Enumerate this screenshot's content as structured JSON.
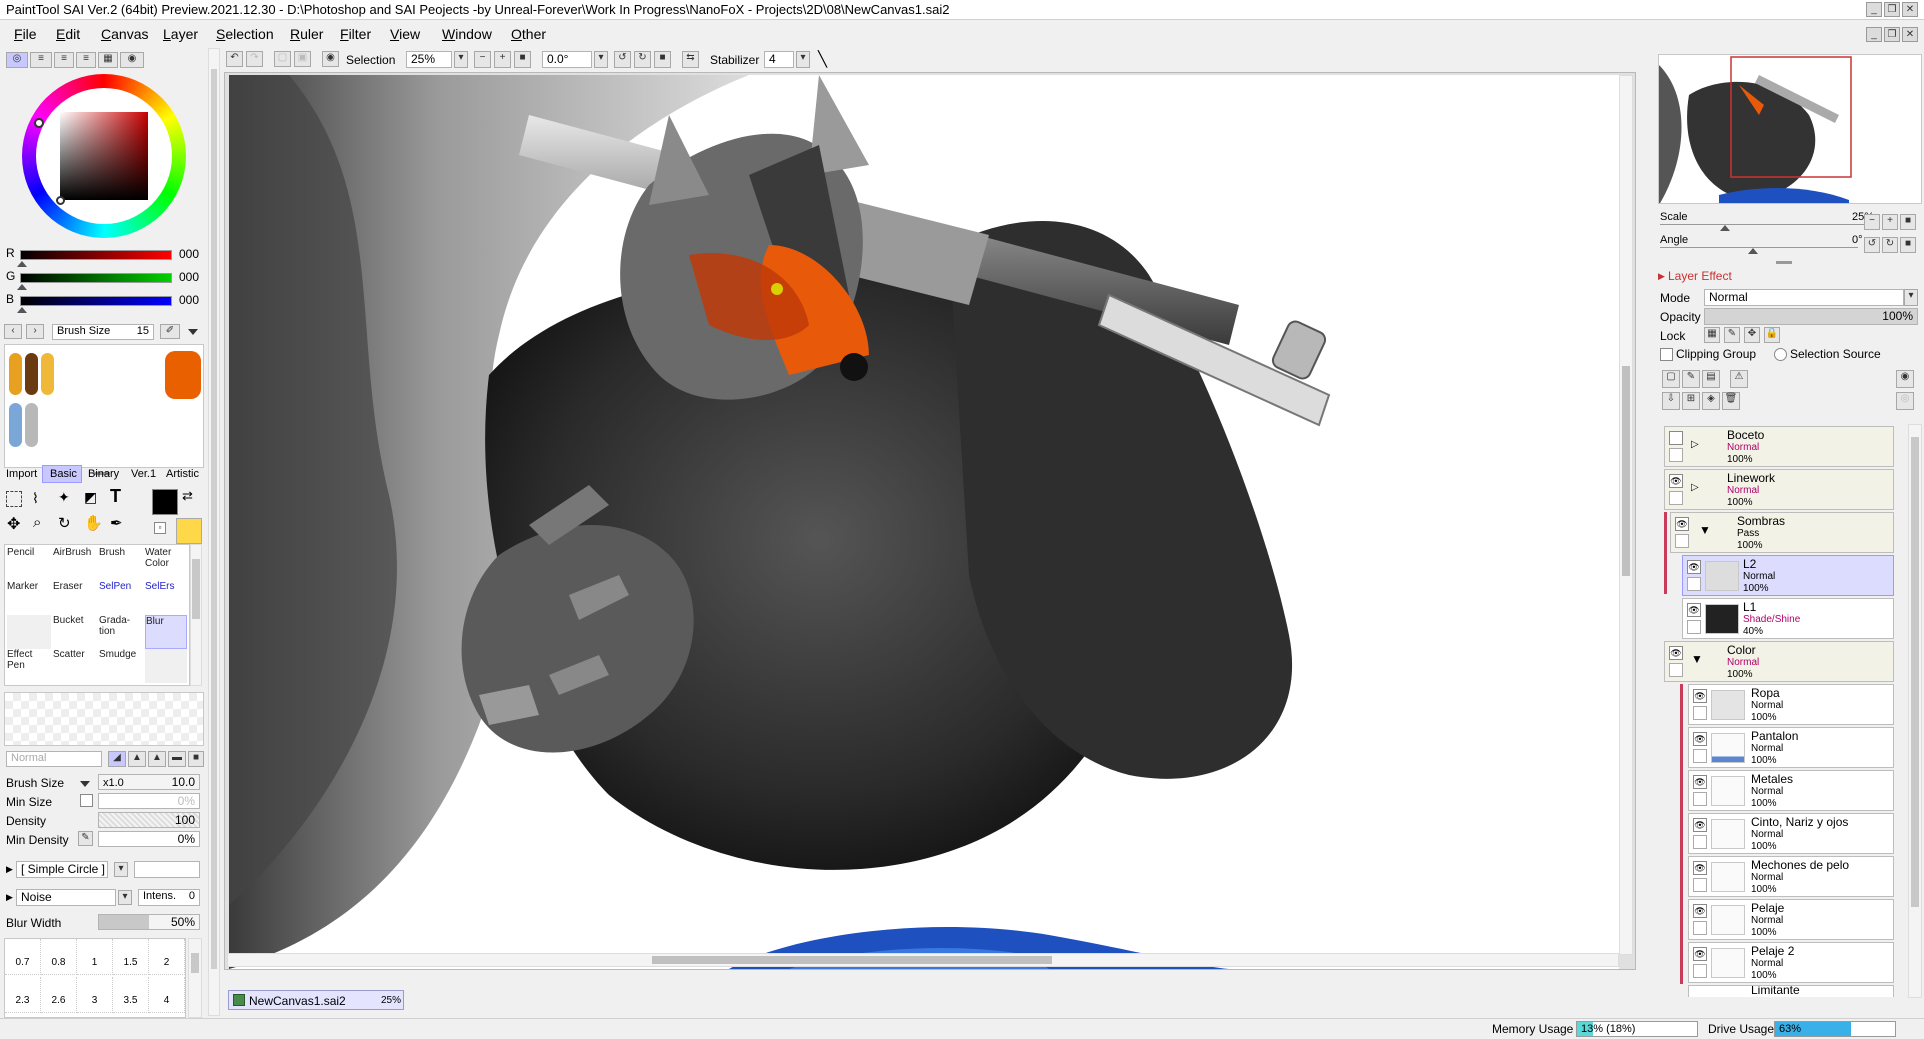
{
  "window": {
    "title": "PaintTool SAI Ver.2 (64bit) Preview.2021.12.30 - D:\\Photoshop and SAI Peojects -by Unreal-Forever\\Work In Progress\\NanoFoX - Projects\\2D\\08\\NewCanvas1.sai2"
  },
  "menu": [
    {
      "key": "F",
      "rest": "ile"
    },
    {
      "key": "E",
      "rest": "dit"
    },
    {
      "key": "C",
      "rest": "anvas"
    },
    {
      "key": "L",
      "rest": "ayer"
    },
    {
      "key": "S",
      "rest": "election"
    },
    {
      "key": "R",
      "rest": "uler"
    },
    {
      "key": "F",
      "rest": "ilter"
    },
    {
      "key": "V",
      "rest": "iew"
    },
    {
      "key": "W",
      "rest": "indow"
    },
    {
      "key": "O",
      "rest": "ther"
    }
  ],
  "canvas_toolbar": {
    "selection_label": "Selection",
    "zoom": "25%",
    "angle": "0.0°",
    "stabilizer_label": "Stabilizer",
    "stabilizer_value": "4"
  },
  "colors": {
    "accent_red": "#c83232",
    "selected_layer": "#dcdcff",
    "folder_layer": "#f2f2e6",
    "layer_mode_pink": "#b0006a",
    "canvas_bg": "#ffffff",
    "primary_color": "#000000",
    "secondary_color": "#ffd84a"
  },
  "rgb": [
    {
      "label": "R",
      "value": "000"
    },
    {
      "label": "G",
      "value": "000"
    },
    {
      "label": "B",
      "value": "000"
    }
  ],
  "brush_size_header": {
    "label": "Brush Size",
    "value": "15"
  },
  "tool_tabs": [
    "Import",
    "Basic",
    "Binary",
    "Ver.1",
    "Artistic"
  ],
  "tool_tabs_active": "Basic",
  "tools": [
    {
      "label": "Pencil"
    },
    {
      "label": "AirBrush"
    },
    {
      "label": "Brush"
    },
    {
      "label": "Water Color"
    },
    {
      "label": "Marker"
    },
    {
      "label": "Eraser"
    },
    {
      "label": "SelPen"
    },
    {
      "label": "SelErs"
    },
    {
      "label": ""
    },
    {
      "label": "Bucket"
    },
    {
      "label": "Grada-tion"
    },
    {
      "label": "Blur"
    },
    {
      "label": "Effect Pen"
    },
    {
      "label": "Scatter"
    },
    {
      "label": "Smudge"
    },
    {
      "label": ""
    }
  ],
  "brush_settings": {
    "blend_mode": "Normal",
    "brush_size_label": "Brush Size",
    "brush_size_mult": "x1.0",
    "brush_size_value": "10.0",
    "min_size_label": "Min Size",
    "min_size_value": "0%",
    "density_label": "Density",
    "density_value": "100",
    "min_density_label": "Min Density",
    "min_density_value": "0%",
    "shape": "[ Simple Circle ]",
    "texture": "Noise",
    "intens_label": "Intens.",
    "intens_value": "0",
    "blur_width_label": "Blur Width",
    "blur_width_value": "50%"
  },
  "size_presets_row1": [
    "0.7",
    "0.8",
    "1",
    "1.5",
    "2"
  ],
  "size_presets_row2": [
    "2.3",
    "2.6",
    "3",
    "3.5",
    "4"
  ],
  "navigator": {
    "scale_label": "Scale",
    "scale_value": "25%",
    "angle_label": "Angle",
    "angle_value": "0°"
  },
  "layer_effect_label": "Layer Effect",
  "layer_props": {
    "mode_label": "Mode",
    "mode_value": "Normal",
    "opacity_label": "Opacity",
    "opacity_value": "100%",
    "lock_label": "Lock",
    "clipping_label": "Clipping Group",
    "selection_source_label": "Selection Source"
  },
  "layers": [
    {
      "name": "Boceto",
      "mode": "Normal",
      "opacity": "100%",
      "folder": true
    },
    {
      "name": "Linework",
      "mode": "Normal",
      "opacity": "100%",
      "folder": true
    },
    {
      "name": "Sombras",
      "mode": "Pass",
      "opacity": "100%",
      "folder": true
    },
    {
      "name": "L2",
      "mode": "Normal",
      "opacity": "100%"
    },
    {
      "name": "L1",
      "mode": "Shade/Shine",
      "opacity": "40%"
    },
    {
      "name": "Color",
      "mode": "Normal",
      "opacity": "100%",
      "folder": true
    },
    {
      "name": "Ropa",
      "mode": "Normal",
      "opacity": "100%"
    },
    {
      "name": "Pantalon",
      "mode": "Normal",
      "opacity": "100%"
    },
    {
      "name": "Metales",
      "mode": "Normal",
      "opacity": "100%"
    },
    {
      "name": "Cinto, Nariz y ojos",
      "mode": "Normal",
      "opacity": "100%"
    },
    {
      "name": "Mechones de pelo",
      "mode": "Normal",
      "opacity": "100%"
    },
    {
      "name": "Pelaje",
      "mode": "Normal",
      "opacity": "100%"
    },
    {
      "name": "Pelaje 2",
      "mode": "Normal",
      "opacity": "100%"
    },
    {
      "name": "Limitante",
      "mode": "",
      "opacity": ""
    }
  ],
  "document_tab": {
    "name": "NewCanvas1.sai2",
    "zoom": "25%"
  },
  "status": {
    "memory_label": "Memory Usage",
    "memory_value": "13% (18%)",
    "memory_fraction": 0.13,
    "drive_label": "Drive Usage",
    "drive_value": "63%",
    "drive_fraction": 0.63
  }
}
